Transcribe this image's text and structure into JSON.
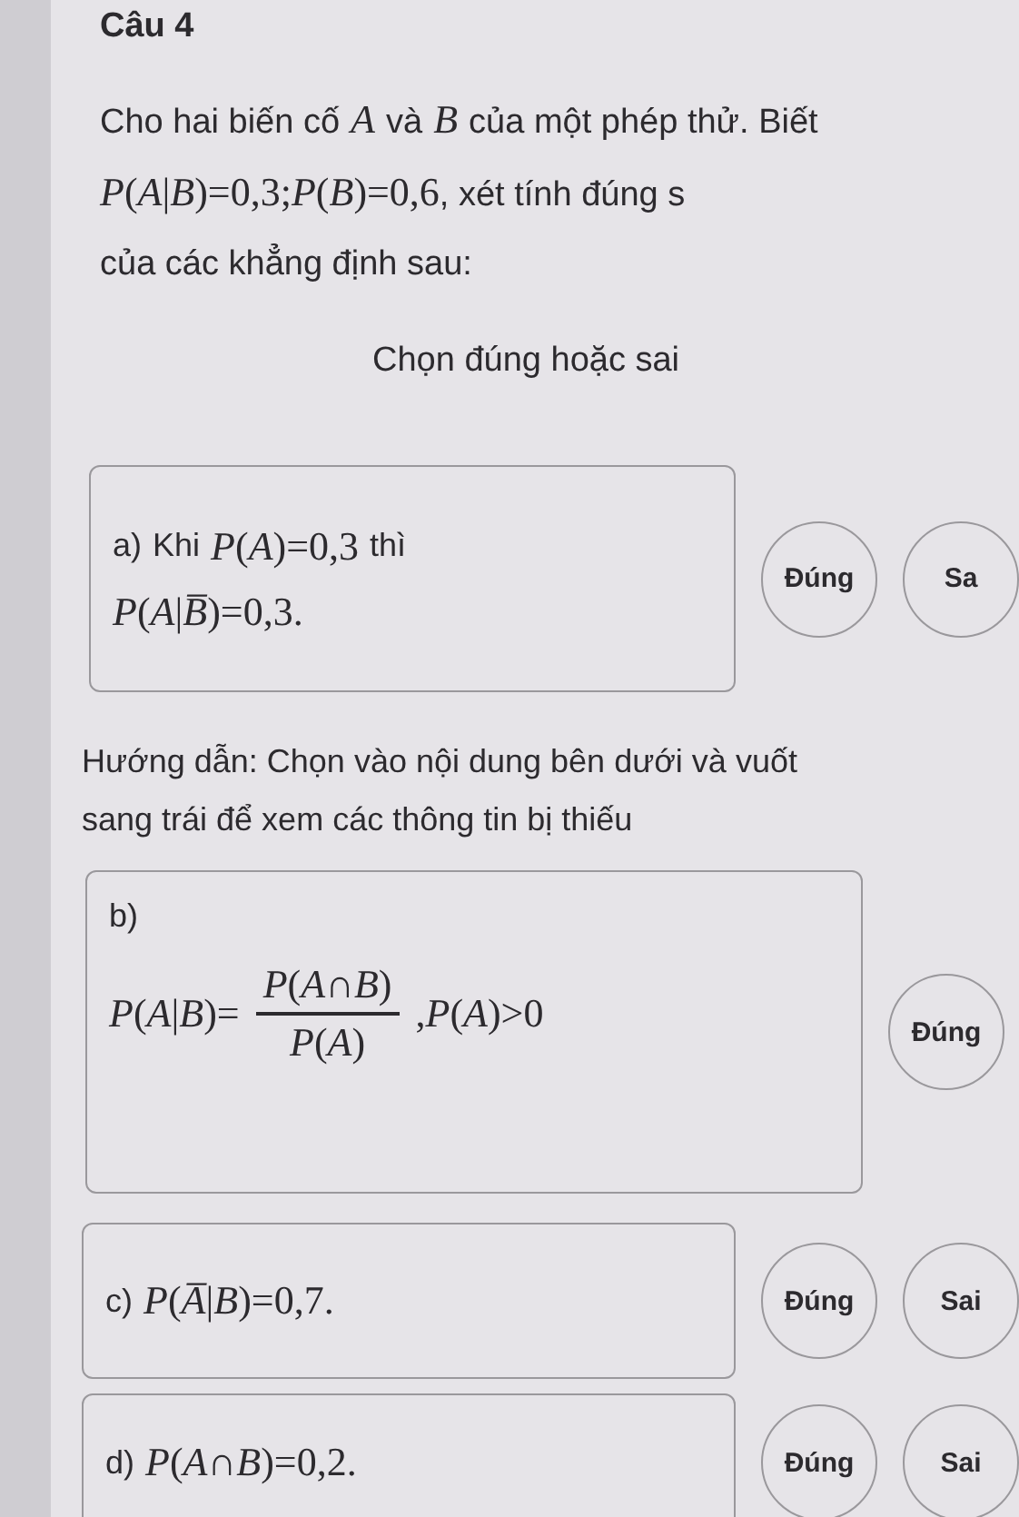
{
  "question": {
    "title": "Câu 4",
    "lines": [
      [
        {
          "kind": "text",
          "text": "Cho hai biến cố"
        },
        {
          "kind": "math",
          "text": "*A*"
        },
        {
          "kind": "text",
          "text": "và"
        },
        {
          "kind": "math",
          "text": "*B*"
        },
        {
          "kind": "text",
          "text": "của một phép thử. Biết"
        }
      ],
      [
        {
          "kind": "math",
          "text": "*P*(*A*|*B*)=0,3;*P*(*B*)=0,6"
        },
        {
          "kind": "text",
          "text": ", xét tính đúng s"
        }
      ],
      [
        {
          "kind": "text",
          "text": "của các khẳng định sau:"
        }
      ]
    ]
  },
  "section_title": "Chọn đúng hoặc sai",
  "blocks": [
    {
      "kind": "statement",
      "label": "a)",
      "lines": [
        [
          {
            "kind": "text",
            "text": "Khi"
          },
          {
            "kind": "math",
            "text": "*P*(*A*)=0,3"
          },
          {
            "kind": "text",
            "text": "thì"
          }
        ],
        [
          {
            "kind": "math",
            "text": "*P*(*A*|*B̅*)=0,3."
          }
        ]
      ],
      "buttons": [
        {
          "label": "Đúng",
          "selected": false
        },
        {
          "label": "Sa",
          "selected": false
        }
      ]
    },
    {
      "kind": "hint",
      "text": "Hướng dẫn: Chọn vào nội dung bên dưới và vuốt sang trái để xem các thông tin bị thiếu"
    },
    {
      "kind": "statement",
      "label": "b)",
      "lines": [
        [
          {
            "kind": "math",
            "text": "*P*(*A*|*B*)="
          },
          {
            "kind": "fraction",
            "numerator": "*P*(*A*∩*B*)",
            "denominator": "*P*(*A*)"
          },
          {
            "kind": "math",
            "text": ",*P*(*A*)>0"
          }
        ]
      ],
      "buttons": [
        {
          "label": "Đúng",
          "selected": false
        }
      ]
    },
    {
      "kind": "statement",
      "label": "c)",
      "lines": [
        [
          {
            "kind": "math",
            "text": "*P*(*A̅*|*B*)=0,7."
          }
        ]
      ],
      "buttons": [
        {
          "label": "Đúng",
          "selected": false
        },
        {
          "label": "Sai",
          "selected": false
        }
      ]
    },
    {
      "kind": "statement",
      "label": "d)",
      "lines": [
        [
          {
            "kind": "math",
            "text": "*P*(*A*∩*B*)=0,2."
          }
        ]
      ],
      "buttons": [
        {
          "label": "Đúng",
          "selected": false
        },
        {
          "label": "Sai",
          "selected": false
        }
      ]
    }
  ]
}
